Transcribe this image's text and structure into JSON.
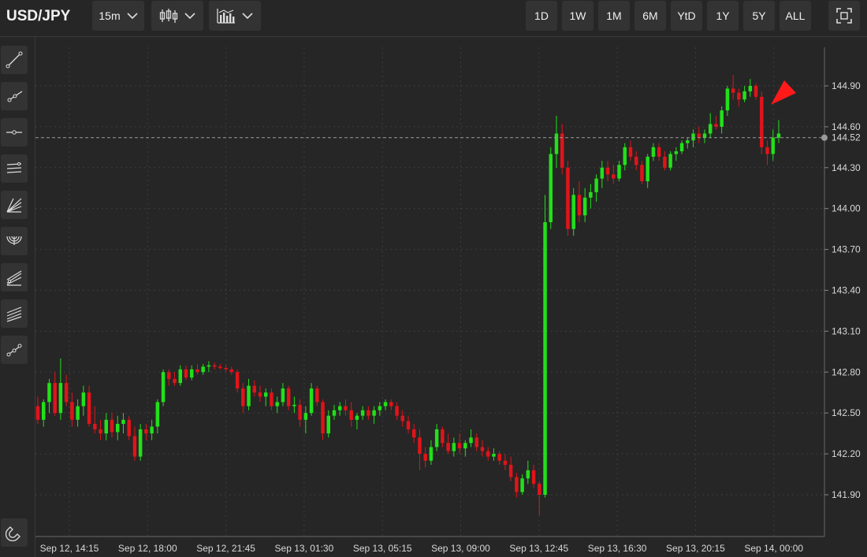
{
  "header": {
    "symbol": "USD/JPY",
    "interval": "15m",
    "ranges": [
      "1D",
      "1W",
      "1M",
      "6M",
      "YtD",
      "1Y",
      "5Y",
      "ALL"
    ]
  },
  "icons": {
    "chart_type": "candlestick-icon",
    "indicators": "indicators-icon",
    "fullscreen": "fullscreen-icon",
    "tools": [
      "trend-line-icon",
      "ray-icon",
      "horizontal-line-icon",
      "channel-icon",
      "fib-fan-icon",
      "fib-arc-icon",
      "pitchfork-icon",
      "parallel-channel-icon",
      "path-icon"
    ],
    "magnet": "magnet-icon"
  },
  "colors": {
    "up": "#22e01a",
    "down": "#e0141a",
    "background": "#262626",
    "grid": "#3d3d3d"
  },
  "chart_data": {
    "type": "candlestick",
    "symbol": "USD/JPY",
    "interval": "15m",
    "ylim": [
      141.7,
      145.22
    ],
    "yticks": [
      144.9,
      144.6,
      144.3,
      144.0,
      143.7,
      143.4,
      143.1,
      142.8,
      142.5,
      142.2,
      141.9
    ],
    "ytick_labels": [
      "144.90",
      "144.60",
      "144.30",
      "144.00",
      "143.70",
      "143.40",
      "143.10",
      "142.80",
      "142.50",
      "142.20",
      "141.90"
    ],
    "xtick_labels": [
      "Sep 12, 14:15",
      "Sep 12, 18:00",
      "Sep 12, 21:45",
      "Sep 13, 01:30",
      "Sep 13, 05:15",
      "Sep 13, 09:00",
      "Sep 13, 12:45",
      "Sep 13, 16:30",
      "Sep 13, 20:15",
      "Sep 14, 00:00"
    ],
    "last_price": 144.52,
    "last_price_label": "144.52",
    "grid": true,
    "ohlc": [
      [
        142.55,
        142.62,
        142.42,
        142.45
      ],
      [
        142.45,
        142.6,
        142.4,
        142.58
      ],
      [
        142.58,
        142.75,
        142.5,
        142.72
      ],
      [
        142.72,
        142.8,
        142.48,
        142.5
      ],
      [
        142.5,
        142.9,
        142.45,
        142.72
      ],
      [
        142.72,
        142.78,
        142.55,
        142.58
      ],
      [
        142.58,
        142.65,
        142.4,
        142.45
      ],
      [
        142.45,
        142.6,
        142.4,
        142.55
      ],
      [
        142.55,
        142.7,
        142.48,
        142.65
      ],
      [
        142.65,
        142.7,
        142.4,
        142.42
      ],
      [
        142.42,
        142.55,
        142.35,
        142.38
      ],
      [
        142.38,
        142.45,
        142.3,
        142.35
      ],
      [
        142.35,
        142.5,
        142.3,
        142.45
      ],
      [
        142.45,
        142.5,
        142.32,
        142.36
      ],
      [
        142.36,
        142.48,
        142.3,
        142.42
      ],
      [
        142.42,
        142.5,
        142.35,
        142.45
      ],
      [
        142.45,
        142.48,
        142.3,
        142.33
      ],
      [
        142.33,
        142.4,
        142.15,
        142.18
      ],
      [
        142.18,
        142.42,
        142.15,
        142.38
      ],
      [
        142.38,
        142.42,
        142.3,
        142.35
      ],
      [
        142.35,
        142.45,
        142.3,
        142.4
      ],
      [
        142.4,
        142.6,
        142.35,
        142.58
      ],
      [
        142.58,
        142.82,
        142.55,
        142.8
      ],
      [
        142.8,
        142.82,
        142.7,
        142.75
      ],
      [
        142.75,
        142.8,
        142.7,
        142.72
      ],
      [
        142.72,
        142.85,
        142.7,
        142.82
      ],
      [
        142.82,
        142.85,
        142.74,
        142.76
      ],
      [
        142.76,
        142.85,
        142.74,
        142.82
      ],
      [
        142.82,
        142.86,
        142.78,
        142.8
      ],
      [
        142.8,
        142.86,
        142.78,
        142.84
      ],
      [
        142.84,
        142.88,
        142.8,
        142.85
      ],
      [
        142.85,
        142.87,
        142.82,
        142.84
      ],
      [
        142.84,
        142.86,
        142.82,
        142.83
      ],
      [
        142.83,
        142.85,
        142.8,
        142.82
      ],
      [
        142.82,
        142.84,
        142.78,
        142.8
      ],
      [
        142.8,
        142.82,
        142.65,
        142.68
      ],
      [
        142.68,
        142.72,
        142.5,
        142.55
      ],
      [
        142.55,
        142.75,
        142.52,
        142.7
      ],
      [
        142.7,
        142.74,
        142.62,
        142.65
      ],
      [
        142.65,
        142.7,
        142.58,
        142.62
      ],
      [
        142.62,
        142.68,
        142.55,
        142.65
      ],
      [
        142.65,
        142.68,
        142.52,
        142.55
      ],
      [
        142.55,
        142.62,
        142.5,
        142.58
      ],
      [
        142.58,
        142.72,
        142.55,
        142.68
      ],
      [
        142.68,
        142.7,
        142.52,
        142.55
      ],
      [
        142.55,
        142.62,
        142.5,
        142.56
      ],
      [
        142.56,
        142.6,
        142.4,
        142.45
      ],
      [
        142.45,
        142.55,
        142.35,
        142.5
      ],
      [
        142.5,
        142.72,
        142.48,
        142.68
      ],
      [
        142.68,
        142.7,
        142.55,
        142.58
      ],
      [
        142.58,
        142.6,
        142.3,
        142.35
      ],
      [
        142.35,
        142.52,
        142.32,
        142.48
      ],
      [
        142.48,
        142.56,
        142.45,
        142.52
      ],
      [
        142.52,
        142.58,
        142.48,
        142.55
      ],
      [
        142.55,
        142.6,
        142.48,
        142.52
      ],
      [
        142.52,
        142.58,
        142.4,
        142.45
      ],
      [
        142.45,
        142.5,
        142.38,
        142.48
      ],
      [
        142.48,
        142.55,
        142.45,
        142.52
      ],
      [
        142.52,
        142.55,
        142.45,
        142.48
      ],
      [
        142.48,
        142.55,
        142.42,
        142.52
      ],
      [
        142.52,
        142.58,
        142.48,
        142.55
      ],
      [
        142.55,
        142.6,
        142.52,
        142.58
      ],
      [
        142.58,
        142.6,
        142.52,
        142.55
      ],
      [
        142.55,
        142.58,
        142.45,
        142.48
      ],
      [
        142.48,
        142.52,
        142.4,
        142.44
      ],
      [
        142.44,
        142.48,
        142.35,
        142.38
      ],
      [
        142.38,
        142.42,
        142.28,
        142.32
      ],
      [
        142.32,
        142.38,
        142.08,
        142.2
      ],
      [
        142.2,
        142.25,
        142.1,
        142.15
      ],
      [
        142.15,
        142.3,
        142.12,
        142.25
      ],
      [
        142.25,
        142.42,
        142.22,
        142.38
      ],
      [
        142.38,
        142.4,
        142.25,
        142.28
      ],
      [
        142.28,
        142.35,
        142.2,
        142.22
      ],
      [
        142.22,
        142.32,
        142.18,
        142.28
      ],
      [
        142.28,
        142.35,
        142.2,
        142.24
      ],
      [
        142.24,
        142.3,
        142.18,
        142.28
      ],
      [
        142.28,
        142.38,
        142.25,
        142.32
      ],
      [
        142.32,
        142.35,
        142.22,
        142.25
      ],
      [
        142.25,
        142.3,
        142.18,
        142.22
      ],
      [
        142.22,
        142.25,
        142.15,
        142.18
      ],
      [
        142.18,
        142.24,
        142.15,
        142.2
      ],
      [
        142.2,
        142.22,
        142.12,
        142.15
      ],
      [
        142.15,
        142.2,
        142.08,
        142.12
      ],
      [
        142.12,
        142.18,
        142.0,
        142.03
      ],
      [
        142.03,
        142.06,
        141.88,
        141.92
      ],
      [
        141.92,
        142.05,
        141.9,
        142.02
      ],
      [
        142.02,
        142.15,
        141.98,
        142.08
      ],
      [
        142.08,
        142.12,
        141.95,
        141.98
      ],
      [
        141.98,
        142.0,
        141.75,
        141.9
      ],
      [
        141.9,
        144.1,
        141.88,
        143.9
      ],
      [
        143.9,
        144.45,
        143.85,
        144.4
      ],
      [
        144.4,
        144.68,
        144.3,
        144.55
      ],
      [
        144.55,
        144.62,
        144.25,
        144.3
      ],
      [
        144.3,
        144.35,
        143.8,
        143.85
      ],
      [
        143.85,
        144.15,
        143.8,
        144.1
      ],
      [
        144.1,
        144.2,
        143.9,
        143.95
      ],
      [
        143.95,
        144.15,
        143.9,
        144.08
      ],
      [
        144.08,
        144.18,
        144.0,
        144.12
      ],
      [
        144.12,
        144.25,
        144.05,
        144.22
      ],
      [
        144.22,
        144.35,
        144.15,
        144.3
      ],
      [
        144.3,
        144.35,
        144.2,
        144.25
      ],
      [
        144.25,
        144.32,
        144.18,
        144.22
      ],
      [
        144.22,
        144.35,
        144.2,
        144.32
      ],
      [
        144.32,
        144.48,
        144.28,
        144.45
      ],
      [
        144.45,
        144.5,
        144.35,
        144.38
      ],
      [
        144.38,
        144.42,
        144.28,
        144.32
      ],
      [
        144.32,
        144.35,
        144.18,
        144.2
      ],
      [
        144.2,
        144.4,
        144.15,
        144.38
      ],
      [
        144.38,
        144.48,
        144.35,
        144.45
      ],
      [
        144.45,
        144.48,
        144.35,
        144.38
      ],
      [
        144.38,
        144.42,
        144.28,
        144.3
      ],
      [
        144.3,
        144.42,
        144.28,
        144.4
      ],
      [
        144.4,
        144.45,
        144.35,
        144.42
      ],
      [
        144.42,
        144.5,
        144.4,
        144.48
      ],
      [
        144.48,
        144.52,
        144.44,
        144.5
      ],
      [
        144.5,
        144.58,
        144.45,
        144.55
      ],
      [
        144.55,
        144.6,
        144.48,
        144.52
      ],
      [
        144.52,
        144.58,
        144.48,
        144.55
      ],
      [
        144.55,
        144.7,
        144.52,
        144.62
      ],
      [
        144.62,
        144.68,
        144.58,
        144.6
      ],
      [
        144.6,
        144.75,
        144.55,
        144.72
      ],
      [
        144.72,
        144.9,
        144.68,
        144.88
      ],
      [
        144.88,
        144.98,
        144.8,
        144.85
      ],
      [
        144.85,
        144.88,
        144.75,
        144.8
      ],
      [
        144.8,
        144.9,
        144.78,
        144.86
      ],
      [
        144.86,
        144.95,
        144.82,
        144.9
      ],
      [
        144.9,
        144.92,
        144.8,
        144.82
      ],
      [
        144.82,
        144.86,
        144.4,
        144.45
      ],
      [
        144.45,
        144.5,
        144.32,
        144.4
      ],
      [
        144.4,
        144.58,
        144.35,
        144.52
      ],
      [
        144.52,
        144.65,
        144.48,
        144.55
      ]
    ],
    "annotation": "red-arrow-marker"
  }
}
